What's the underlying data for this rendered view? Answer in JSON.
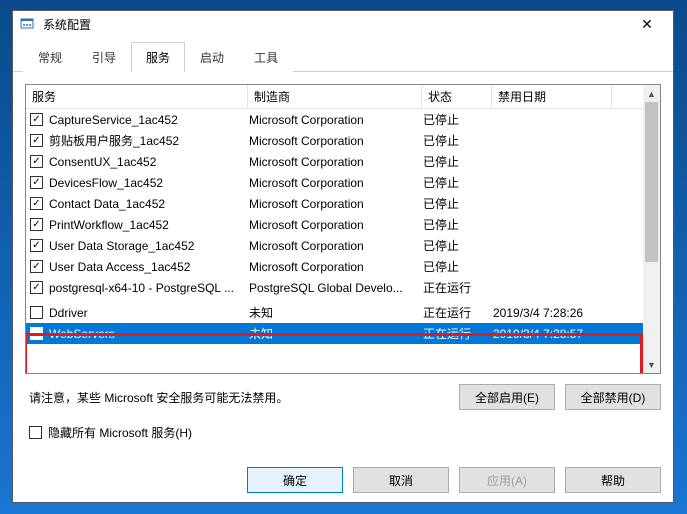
{
  "window": {
    "title": "系统配置",
    "close_icon": "✕"
  },
  "tabs": [
    {
      "label": "常规"
    },
    {
      "label": "引导"
    },
    {
      "label": "服务"
    },
    {
      "label": "启动"
    },
    {
      "label": "工具"
    }
  ],
  "active_tab_index": 2,
  "columns": {
    "service": "服务",
    "manufacturer": "制造商",
    "status": "状态",
    "disable_date": "禁用日期"
  },
  "rows": [
    {
      "checked": true,
      "service": "CaptureService_1ac452",
      "manufacturer": "Microsoft Corporation",
      "status": "已停止",
      "date": ""
    },
    {
      "checked": true,
      "service": "剪贴板用户服务_1ac452",
      "manufacturer": "Microsoft Corporation",
      "status": "已停止",
      "date": ""
    },
    {
      "checked": true,
      "service": "ConsentUX_1ac452",
      "manufacturer": "Microsoft Corporation",
      "status": "已停止",
      "date": ""
    },
    {
      "checked": true,
      "service": "DevicesFlow_1ac452",
      "manufacturer": "Microsoft Corporation",
      "status": "已停止",
      "date": ""
    },
    {
      "checked": true,
      "service": "Contact Data_1ac452",
      "manufacturer": "Microsoft Corporation",
      "status": "已停止",
      "date": ""
    },
    {
      "checked": true,
      "service": "PrintWorkflow_1ac452",
      "manufacturer": "Microsoft Corporation",
      "status": "已停止",
      "date": ""
    },
    {
      "checked": true,
      "service": "User Data Storage_1ac452",
      "manufacturer": "Microsoft Corporation",
      "status": "已停止",
      "date": ""
    },
    {
      "checked": true,
      "service": "User Data Access_1ac452",
      "manufacturer": "Microsoft Corporation",
      "status": "已停止",
      "date": ""
    },
    {
      "checked": true,
      "service": "postgresql-x64-10 - PostgreSQL ...",
      "manufacturer": "PostgreSQL Global Develo...",
      "status": "正在运行",
      "date": ""
    },
    {
      "checked": false,
      "service": "Ddriver",
      "manufacturer": "未知",
      "status": "正在运行",
      "date": "2019/3/4 7:28:26"
    },
    {
      "checked": false,
      "service": "WebServers",
      "manufacturer": "未知",
      "status": "正在运行",
      "date": "2019/3/4 7:28:57"
    }
  ],
  "selected_row_index": 10,
  "note_text": "请注意，某些 Microsoft 安全服务可能无法禁用。",
  "buttons": {
    "enable_all": "全部启用(E)",
    "disable_all": "全部禁用(D)"
  },
  "hide_ms_label": "隐藏所有 Microsoft 服务(H)",
  "dialog_buttons": {
    "ok": "确定",
    "cancel": "取消",
    "apply": "应用(A)",
    "help": "帮助"
  },
  "scroll": {
    "up_glyph": "▲",
    "down_glyph": "▼"
  }
}
